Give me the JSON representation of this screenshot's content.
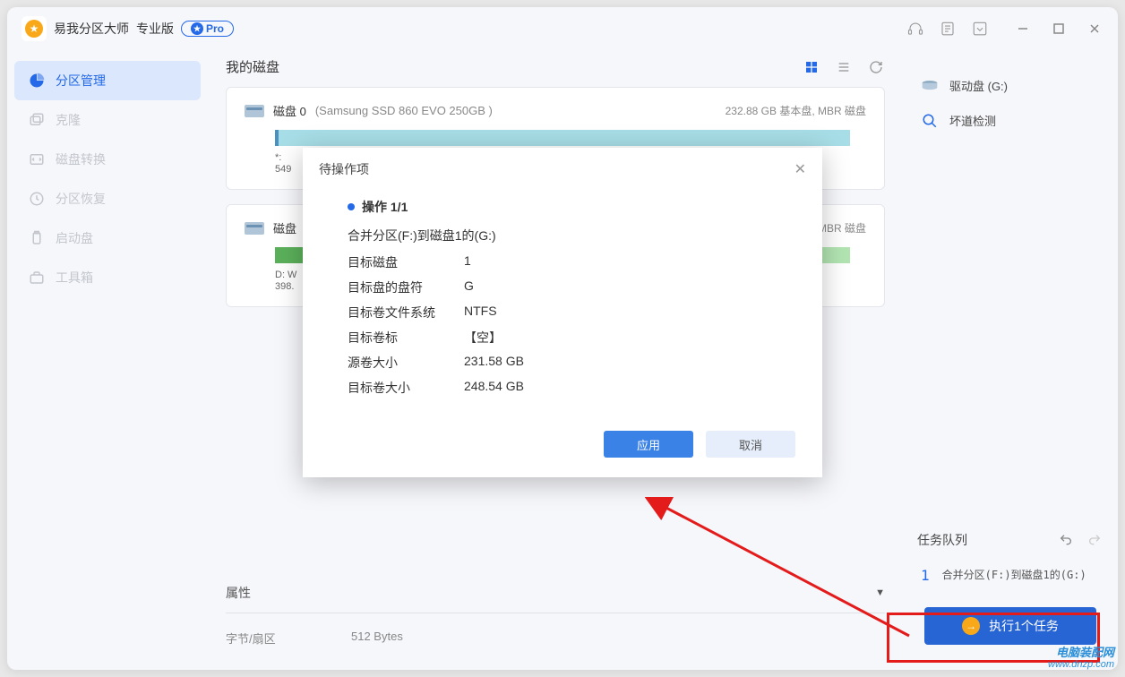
{
  "app": {
    "title": "易我分区大师",
    "edition": "专业版",
    "pro_badge": "Pro"
  },
  "sidebar": {
    "items": [
      {
        "label": "分区管理"
      },
      {
        "label": "克隆"
      },
      {
        "label": "磁盘转换"
      },
      {
        "label": "分区恢复"
      },
      {
        "label": "启动盘"
      },
      {
        "label": "工具箱"
      }
    ]
  },
  "main": {
    "title": "我的磁盘",
    "disks": [
      {
        "name": "磁盘 0",
        "model": "(Samsung SSD 860 EVO 250GB )",
        "meta": "232.88 GB 基本盘, MBR 磁盘",
        "info1": "*: ",
        "info2": "549 "
      },
      {
        "name": "磁盘",
        "meta": "MBR 磁盘",
        "info1": "D: W",
        "info2": "398."
      }
    ],
    "props": {
      "title": "属性",
      "row_label": "字节/扇区",
      "row_value": "512 Bytes"
    }
  },
  "rightpanel": {
    "items": [
      {
        "label": "驱动盘  (G:)"
      },
      {
        "label": "坏道检测"
      }
    ],
    "queue_title": "任务队列",
    "queue_items": [
      {
        "num": "1",
        "text": "合并分区(F:)到磁盘1的(G:)"
      }
    ],
    "exec_label": "执行1个任务"
  },
  "dialog": {
    "title": "待操作项",
    "op_header": "操作 1/1",
    "op_desc": "合并分区(F:)到磁盘1的(G:)",
    "rows": [
      {
        "label": "目标磁盘",
        "value": "1"
      },
      {
        "label": "目标盘的盘符",
        "value": "G"
      },
      {
        "label": "目标卷文件系统",
        "value": "NTFS"
      },
      {
        "label": "目标卷标",
        "value": "【空】"
      },
      {
        "label": "源卷大小",
        "value": "231.58 GB"
      },
      {
        "label": "目标卷大小",
        "value": "248.54 GB"
      }
    ],
    "apply": "应用",
    "cancel": "取消"
  },
  "watermark": {
    "line1": "电脑装配网",
    "line2": "www.dnzp.com"
  }
}
